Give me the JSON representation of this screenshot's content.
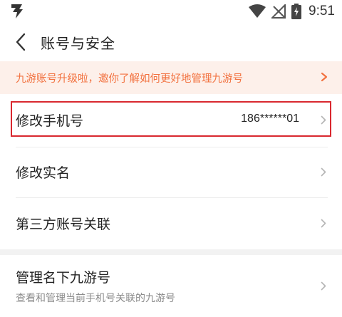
{
  "status_bar": {
    "time": "9:51",
    "icons": [
      "app-badge-icon",
      "wifi-icon",
      "no-signal-icon",
      "battery-charging-icon"
    ]
  },
  "nav": {
    "title": "账号与安全",
    "back_icon": "chevron-left-icon"
  },
  "banner": {
    "text": "九游账号升级啦，邀你了解如何更好地管理九游号",
    "color": "#f27240",
    "background": "#fdf0ea"
  },
  "settings": {
    "change_phone": {
      "label": "修改手机号",
      "value": "186******01"
    },
    "change_realname": {
      "label": "修改实名"
    },
    "third_party": {
      "label": "第三方账号关联"
    },
    "manage_accounts": {
      "label": "管理名下九游号",
      "sub": "查看和管理当前手机号关联的九游号"
    }
  },
  "accent_colors": {
    "highlight_border": "#d9282f"
  }
}
